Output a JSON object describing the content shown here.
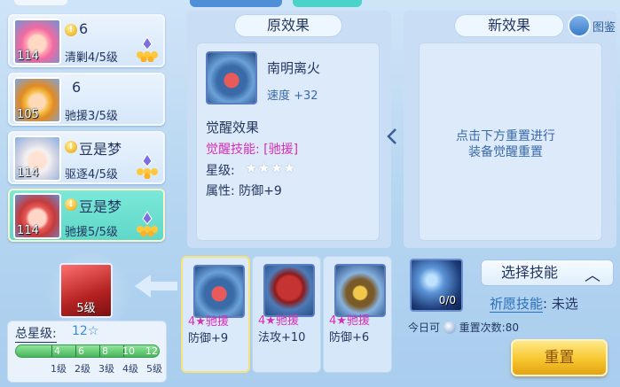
{
  "heroes": [
    {
      "name": "6",
      "level": "114",
      "skill": "清剿4/5级",
      "selected": false
    },
    {
      "name": "6",
      "level": "105",
      "skill": "驰援3/5级",
      "selected": false
    },
    {
      "name": "豆是梦",
      "level": "114",
      "skill": "驱逐4/5级",
      "selected": false
    },
    {
      "name": "豆是梦",
      "level": "114",
      "skill": "驰援5/5级",
      "selected": true
    }
  ],
  "current_equipment": {
    "level": "5级"
  },
  "star_summary": {
    "title": "总星级:",
    "value": "12☆",
    "thresholds": [
      "4",
      "6",
      "8",
      "10",
      "12"
    ],
    "levels": [
      "1级",
      "2级",
      "3级",
      "4级",
      "5级"
    ]
  },
  "original_effect": {
    "header": "原效果",
    "item_name": "南明离火",
    "item_stat": "速度 +32",
    "awaken_title": "觉醒效果",
    "awaken_skill": "觉醒技能: [驰援]",
    "star_label": "星级:",
    "stars": "★★★★",
    "attr": "属性:  防御+9"
  },
  "new_effect": {
    "header": "新效果",
    "handbook": "图鉴",
    "hint_line1": "点击下方重置进行",
    "hint_line2": "装备觉醒重置"
  },
  "candidates": [
    {
      "title": "4★驰援",
      "stat": "防御+9"
    },
    {
      "title": "4★驰援",
      "stat": "法攻+10"
    },
    {
      "title": "4★驰援",
      "stat": "防御+6"
    }
  ],
  "controls": {
    "stone_count": "0/0",
    "select_skill": "选择技能",
    "wish_label": "祈愿技能",
    "wish_value": ": 未选",
    "today_label": "今日可",
    "reset_count": "重置次数:80",
    "reset_button": "重置"
  }
}
